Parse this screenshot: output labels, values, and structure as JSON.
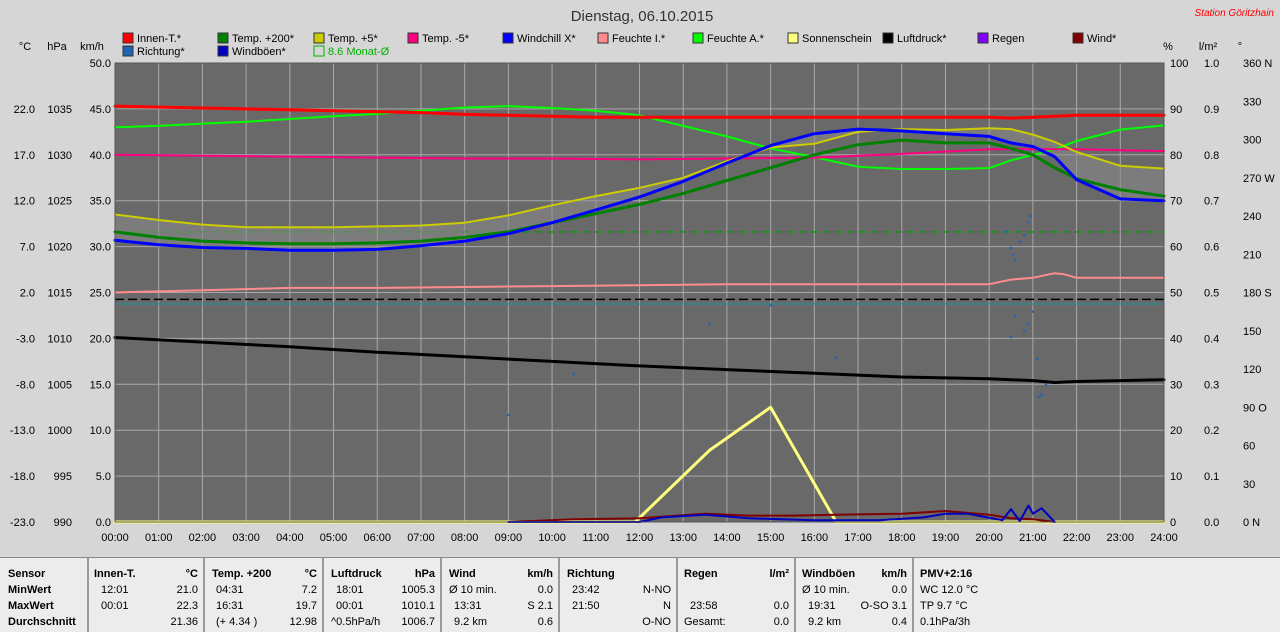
{
  "colors": {
    "innen_t": "#ff0000",
    "temp_200": "#008000",
    "temp_5": "#cccc00",
    "temp_m5": "#ff0080",
    "windchill": "#0000ff",
    "feuchte_i": "#ff8c8c",
    "feuchte_a": "#00ff00",
    "sonnenschein": "#ffff80",
    "luftdruck": "#000000",
    "regen": "#8000ff",
    "wind": "#800000",
    "richtung": "#1e64b4",
    "windboeen": "#0000c0",
    "monat": "#00b000",
    "station": "#ff0000",
    "plot_bg": "#696969"
  },
  "title": "Dienstag, 06.10.2015",
  "station": "Station Göritzhain",
  "legend": [
    {
      "key": "innen_t",
      "label": "Innen-T.*",
      "color": "#ff0000"
    },
    {
      "key": "temp_200",
      "label": "Temp. +200*",
      "color": "#008000"
    },
    {
      "key": "temp_5",
      "label": "Temp. +5*",
      "color": "#cccc00"
    },
    {
      "key": "temp_m5",
      "label": "Temp. -5*",
      "color": "#ff0080"
    },
    {
      "key": "windchill",
      "label": "Windchill X*",
      "color": "#0000ff"
    },
    {
      "key": "feuchte_i",
      "label": "Feuchte I.*",
      "color": "#ff8c8c"
    },
    {
      "key": "feuchte_a",
      "label": "Feuchte A.*",
      "color": "#00ff00"
    },
    {
      "key": "sonnenschein",
      "label": "Sonnenschein",
      "color": "#ffff80"
    },
    {
      "key": "luftdruck",
      "label": "Luftdruck*",
      "color": "#000000"
    },
    {
      "key": "regen",
      "label": "Regen",
      "color": "#8000ff"
    },
    {
      "key": "wind",
      "label": "Wind*",
      "color": "#800000"
    },
    {
      "key": "richtung",
      "label": "Richtung*",
      "color": "#1e64b4"
    },
    {
      "key": "windboeen",
      "label": "Windböen*",
      "color": "#0000c0"
    },
    {
      "key": "monat",
      "label": "8.6 Monat-Ø",
      "color": "#00b000",
      "hollow": true
    }
  ],
  "unit_headers": {
    "celsius": "°C",
    "hpa": "hPa",
    "kmh": "km/h",
    "percent": "%",
    "lm2": "l/m²",
    "deg": "°"
  },
  "chart_data": {
    "type": "line",
    "title": "Dienstag, 06.10.2015",
    "xlim": [
      0,
      24
    ],
    "x_ticks": [
      "00:00",
      "01:00",
      "02:00",
      "03:00",
      "04:00",
      "05:00",
      "06:00",
      "07:00",
      "08:00",
      "09:00",
      "10:00",
      "11:00",
      "12:00",
      "13:00",
      "14:00",
      "15:00",
      "16:00",
      "17:00",
      "18:00",
      "19:00",
      "20:00",
      "21:00",
      "22:00",
      "23:00",
      "24:00"
    ],
    "axes": {
      "temp_c": {
        "ticks": [
          "22.0",
          "17.0",
          "12.0",
          "7.0",
          "2.0",
          "-3.0",
          "-8.0",
          "-13.0",
          "-18.0",
          "-23.0"
        ],
        "range": [
          -23,
          27
        ]
      },
      "pressure_hpa": {
        "ticks": [
          "1035",
          "1030",
          "1025",
          "1020",
          "1015",
          "1010",
          "1005",
          "1000",
          "995",
          "990"
        ],
        "range": [
          990,
          1040
        ]
      },
      "wind_kmh": {
        "ticks": [
          "50.0",
          "45.0",
          "40.0",
          "35.0",
          "30.0",
          "25.0",
          "20.0",
          "15.0",
          "10.0",
          "5.0",
          "0.0"
        ],
        "range": [
          0,
          50
        ]
      },
      "humidity_pct": {
        "ticks": [
          "100",
          "90",
          "80",
          "70",
          "60",
          "50",
          "40",
          "30",
          "20",
          "10",
          "0"
        ],
        "range": [
          0,
          100
        ]
      },
      "rain_lm2": {
        "ticks": [
          "1.0",
          "0.9",
          "0.8",
          "0.7",
          "0.6",
          "0.5",
          "0.4",
          "0.3",
          "0.2",
          "0.1",
          "0.0"
        ],
        "range": [
          0,
          1
        ]
      },
      "direction_deg": {
        "ticks": [
          "360 N",
          "330",
          "300",
          "270 W",
          "240",
          "210",
          "180 S",
          "150",
          "120",
          "90 O",
          "60",
          "30",
          "0 N"
        ],
        "range": [
          0,
          360
        ]
      }
    },
    "reference_lines": [
      {
        "name": "8.6 Monat-Ø",
        "axis": "temp_c",
        "value": 8.6,
        "style": "dashed",
        "color": "#00a000"
      },
      {
        "axis": "humidity_pct",
        "value": 48.5,
        "style": "dashed",
        "color": "#000000"
      },
      {
        "axis": "humidity_pct",
        "value": 47.5,
        "style": "solid",
        "color": "#2e8b8b"
      }
    ],
    "series": [
      {
        "key": "innen_t",
        "name": "Innen-T.*",
        "axis": "temp_c",
        "color": "#ff0000",
        "x": [
          0,
          1,
          2,
          3,
          4,
          5,
          6,
          7,
          8,
          9,
          10,
          11,
          12,
          13,
          14,
          15,
          16,
          17,
          18,
          19,
          20,
          20.5,
          21,
          21.5,
          22,
          23,
          24
        ],
        "y": [
          22.3,
          22.2,
          22.1,
          22.0,
          21.9,
          21.8,
          21.7,
          21.6,
          21.4,
          21.3,
          21.2,
          21.1,
          21.1,
          21.1,
          21.1,
          21.1,
          21.1,
          21.1,
          21.1,
          21.1,
          21.1,
          21.0,
          21.1,
          21.2,
          21.3,
          21.3,
          21.3
        ]
      },
      {
        "key": "temp_200",
        "name": "Temp. +200*",
        "axis": "temp_c",
        "color": "#008000",
        "x": [
          0,
          1,
          2,
          3,
          4,
          5,
          6,
          7,
          8,
          9,
          10,
          11,
          12,
          13,
          14,
          15,
          16,
          17,
          18,
          19,
          20,
          20.5,
          21,
          21.5,
          22,
          23,
          24
        ],
        "y": [
          8.6,
          8.0,
          7.6,
          7.4,
          7.3,
          7.3,
          7.4,
          7.6,
          8.0,
          8.6,
          9.6,
          10.6,
          11.6,
          12.8,
          14.2,
          15.6,
          17.0,
          18.1,
          18.6,
          18.3,
          18.3,
          17.7,
          17.0,
          15.6,
          14.4,
          13.2,
          12.5
        ]
      },
      {
        "key": "temp_5",
        "name": "Temp. +5*",
        "axis": "temp_c",
        "color": "#cccc00",
        "x": [
          0,
          1,
          2,
          3,
          4,
          5,
          6,
          7,
          8,
          9,
          10,
          11,
          12,
          13,
          14,
          15,
          16,
          17,
          18,
          19,
          20,
          20.5,
          21,
          21.5,
          22,
          23,
          24
        ],
        "y": [
          10.5,
          9.9,
          9.4,
          9.1,
          9.1,
          9.1,
          9.2,
          9.3,
          9.6,
          10.4,
          11.5,
          12.5,
          13.4,
          14.5,
          16.3,
          17.8,
          18.2,
          19.5,
          19.8,
          19.7,
          19.9,
          19.8,
          19.2,
          18.4,
          17.3,
          15.8,
          15.5
        ]
      },
      {
        "key": "temp_m5",
        "name": "Temp. -5*",
        "axis": "temp_c",
        "color": "#ff0080",
        "x": [
          0,
          2,
          4,
          6,
          8,
          10,
          12,
          14,
          16,
          18,
          20,
          22,
          24
        ],
        "y": [
          17.0,
          16.9,
          16.8,
          16.7,
          16.6,
          16.6,
          16.5,
          16.6,
          16.7,
          17.1,
          17.6,
          17.6,
          17.4
        ]
      },
      {
        "key": "windchill",
        "name": "Windchill X*",
        "axis": "temp_c",
        "color": "#0000ff",
        "x": [
          0,
          1,
          2,
          3,
          4,
          5,
          6,
          7,
          8,
          9,
          10,
          11,
          12,
          13,
          14,
          15,
          16,
          17,
          18,
          19,
          20,
          20.5,
          21,
          21.5,
          22,
          23,
          24
        ],
        "y": [
          7.7,
          7.2,
          6.9,
          6.8,
          6.6,
          6.6,
          6.7,
          7.1,
          7.6,
          8.4,
          9.6,
          11.0,
          12.4,
          14.1,
          16.1,
          18.0,
          19.3,
          19.8,
          19.6,
          19.3,
          19.0,
          18.3,
          17.9,
          16.8,
          14.3,
          12.2,
          12.0
        ]
      },
      {
        "key": "feuchte_i",
        "name": "Feuchte I.*",
        "axis": "humidity_pct",
        "color": "#ff8c8c",
        "x": [
          0,
          2,
          4,
          6,
          8,
          10,
          12,
          14,
          16,
          18,
          20,
          20.5,
          21,
          21.5,
          21.7,
          22,
          23,
          24
        ],
        "y": [
          50,
          50.5,
          51,
          51,
          51.2,
          51.4,
          51.6,
          51.8,
          51.8,
          51.8,
          51.8,
          52.8,
          53.2,
          54.2,
          54,
          53.2,
          53.2,
          53.2
        ]
      },
      {
        "key": "feuchte_a",
        "name": "Feuchte A.*",
        "axis": "humidity_pct",
        "color": "#00ff00",
        "x": [
          0,
          1,
          2,
          3,
          4,
          5,
          6,
          7,
          8,
          9,
          10,
          11,
          12,
          13,
          14,
          15,
          16,
          17,
          18,
          19,
          20,
          20.5,
          21,
          21.5,
          22,
          23,
          24
        ],
        "y": [
          86,
          86.3,
          86.8,
          87.2,
          87.8,
          88.4,
          88.9,
          89.6,
          90.3,
          90.6,
          90.2,
          89.6,
          88.6,
          86.3,
          84,
          81.4,
          79.5,
          77.4,
          76.9,
          76.9,
          77.1,
          78.8,
          80,
          81.2,
          83,
          85.5,
          86.4
        ]
      },
      {
        "key": "luftdruck",
        "name": "Luftdruck*",
        "axis": "pressure_hpa",
        "color": "#000000",
        "x": [
          0,
          2,
          4,
          6,
          8,
          10,
          12,
          14,
          16,
          17,
          18,
          19,
          20,
          20.5,
          21,
          21.5,
          22,
          23,
          24
        ],
        "y": [
          1010.1,
          1009.6,
          1009.1,
          1008.5,
          1008,
          1007.5,
          1007,
          1006.6,
          1006.2,
          1006,
          1005.8,
          1005.7,
          1005.6,
          1005.5,
          1005.4,
          1005.2,
          1005.3,
          1005.4,
          1005.5
        ]
      },
      {
        "key": "sonnenschein",
        "name": "Sonnenschein",
        "axis": "wind_kmh",
        "color": "#ffff80",
        "x": [
          0,
          11.9,
          13.6,
          15,
          16.5,
          24
        ],
        "y": [
          0,
          0,
          7.8,
          12.5,
          0,
          0
        ]
      },
      {
        "key": "wind",
        "name": "Wind*",
        "axis": "wind_kmh",
        "color": "#800000",
        "x": [
          9,
          10.5,
          12,
          13.5,
          14.5,
          15.5,
          16.5,
          18,
          19,
          20,
          20.5,
          21,
          21.5
        ],
        "y": [
          0,
          0.3,
          0.4,
          0.9,
          0.7,
          0.7,
          0.8,
          0.9,
          1.2,
          0.8,
          0.4,
          0.3,
          0
        ]
      },
      {
        "key": "windboeen",
        "name": "Windböen*",
        "axis": "wind_kmh",
        "color": "#0000c0",
        "x": [
          9,
          12,
          12.5,
          13.5,
          14.5,
          16,
          17.5,
          18.5,
          19,
          19.5,
          20.3,
          20.5,
          20.7,
          20.9,
          21,
          21.2,
          21.5
        ],
        "y": [
          0,
          0,
          0.5,
          0.8,
          0.4,
          0.2,
          0.2,
          0.5,
          0.9,
          0.9,
          0.2,
          1.4,
          0.1,
          1.8,
          0.9,
          1.5,
          0
        ]
      },
      {
        "key": "richtung",
        "name": "Richtung*",
        "axis": "direction_deg",
        "color": "#1e64b4",
        "style": "dots",
        "x": [
          9.0,
          10.5,
          13.6,
          15.0,
          16.5,
          20.4,
          20.5,
          20.55,
          20.6,
          20.7,
          20.8,
          20.9,
          20.95,
          21.0,
          20.9,
          20.8,
          20.6,
          20.5,
          21.1,
          21.15,
          21.2,
          21.3
        ],
        "y": [
          84,
          116,
          155,
          170,
          129,
          228,
          215,
          210,
          205,
          220,
          225,
          235,
          240,
          165,
          155,
          150,
          162,
          145,
          128,
          98,
          100,
          108
        ]
      }
    ]
  },
  "stats": {
    "sensor": {
      "header": "Sensor",
      "rows": [
        "MinWert",
        "MaxWert",
        "Durchschnitt"
      ]
    },
    "innen_t": {
      "header": "Innen-T.",
      "unit": "°C",
      "rows": [
        [
          "12:01",
          "21.0"
        ],
        [
          "00:01",
          "22.3"
        ],
        [
          "",
          "21.36"
        ]
      ]
    },
    "temp_200": {
      "header": "Temp. +200",
      "unit": "°C",
      "rows": [
        [
          "04:31",
          "7.2"
        ],
        [
          "16:31",
          "19.7"
        ],
        [
          "(+ 4.34 )",
          "12.98"
        ]
      ]
    },
    "luftdruck": {
      "header": "Luftdruck",
      "unit": "hPa",
      "rows": [
        [
          "18:01",
          "1005.3"
        ],
        [
          "00:01",
          "1010.1"
        ],
        [
          "^0.5hPa/h",
          "1006.7"
        ]
      ]
    },
    "wind": {
      "header": "Wind",
      "unit": "km/h",
      "rows": [
        [
          "Ø 10 min.",
          "0.0"
        ],
        [
          "13:31",
          "S 2.1"
        ],
        [
          "9.2 km",
          "0.6"
        ]
      ]
    },
    "richtung": {
      "header": "Richtung",
      "unit": "",
      "rows": [
        [
          "23:42",
          "N-NO"
        ],
        [
          "21:50",
          "N"
        ],
        [
          "",
          "O-NO"
        ]
      ]
    },
    "regen": {
      "header": "Regen",
      "unit": "l/m²",
      "rows": [
        [
          "",
          ""
        ],
        [
          "23:58",
          "0.0"
        ],
        [
          "Gesamt:",
          "0.0"
        ]
      ]
    },
    "windboeen": {
      "header": "Windböen",
      "unit": "km/h",
      "rows": [
        [
          "Ø 10 min.",
          "0.0"
        ],
        [
          "19:31",
          "O-SO 3.1"
        ],
        [
          "9.2 km",
          "0.4"
        ]
      ]
    },
    "pmv": {
      "header": "PMV+2:16",
      "rows": [
        "WC 12.0 °C",
        "TP 9.7 °C",
        "0.1hPa/3h"
      ]
    }
  }
}
